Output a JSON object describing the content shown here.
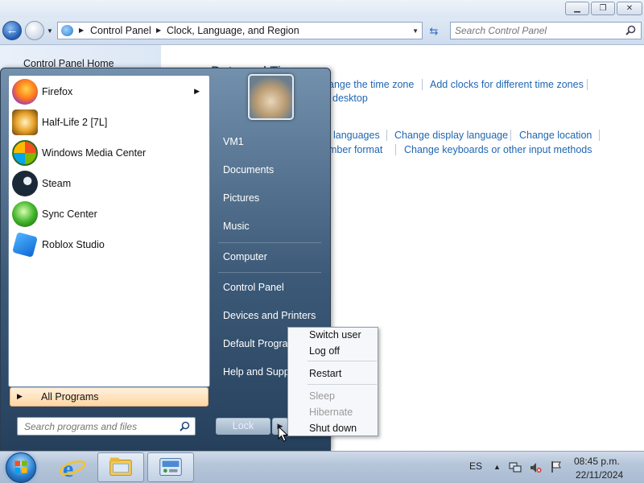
{
  "window": {
    "minimize_glyph": "▁",
    "maximize_glyph": "❐",
    "close_glyph": "✕"
  },
  "address": {
    "crumbs": [
      "Control Panel",
      "Clock, Language, and Region"
    ],
    "search_placeholder": "Search Control Panel"
  },
  "left_pane": {
    "home_label": "Control Panel Home"
  },
  "content": {
    "heading": "Date and Time",
    "links_row1": [
      "ange the time zone",
      "Add clocks for different time zones"
    ],
    "links_row2": [
      "desktop"
    ],
    "links_row3": [
      "languages",
      "Change display language",
      "Change location"
    ],
    "links_row4": [
      "mber format",
      "Change keyboards or other input methods"
    ]
  },
  "start_menu": {
    "programs": [
      {
        "label": "Firefox",
        "icon": "firefox-icon",
        "has_submenu": true
      },
      {
        "label": "Half-Life 2 [7L]",
        "icon": "half-life-icon",
        "has_submenu": false
      },
      {
        "label": "Windows Media Center",
        "icon": "media-center-icon",
        "has_submenu": false
      },
      {
        "label": "Steam",
        "icon": "steam-icon",
        "has_submenu": false
      },
      {
        "label": "Sync Center",
        "icon": "sync-center-icon",
        "has_submenu": false
      },
      {
        "label": "Roblox Studio",
        "icon": "roblox-studio-icon",
        "has_submenu": false
      }
    ],
    "all_programs": "All Programs",
    "search_placeholder": "Search programs and files",
    "right_links": [
      "VM1",
      "Documents",
      "Pictures",
      "Music",
      "Computer",
      "Control Panel",
      "Devices and Printers",
      "Default Programs",
      "Help and Support"
    ],
    "lock_label": "Lock"
  },
  "power_menu": {
    "items": [
      {
        "label": "Switch user",
        "enabled": true
      },
      {
        "label": "Log off",
        "enabled": true
      },
      {
        "label": "Restart",
        "enabled": true
      },
      {
        "label": "Sleep",
        "enabled": false
      },
      {
        "label": "Hibernate",
        "enabled": false
      },
      {
        "label": "Shut down",
        "enabled": true
      }
    ]
  },
  "taskbar": {
    "language": "ES",
    "time": "08:45 p.m.",
    "date": "22/11/2024",
    "pinned": [
      "internet-explorer-icon",
      "windows-explorer-icon",
      "control-panel-icon"
    ]
  },
  "colors": {
    "link": "#1e66b3",
    "start_menu_dark": "#26405c",
    "all_programs_highlight": "#ffd6a3"
  }
}
